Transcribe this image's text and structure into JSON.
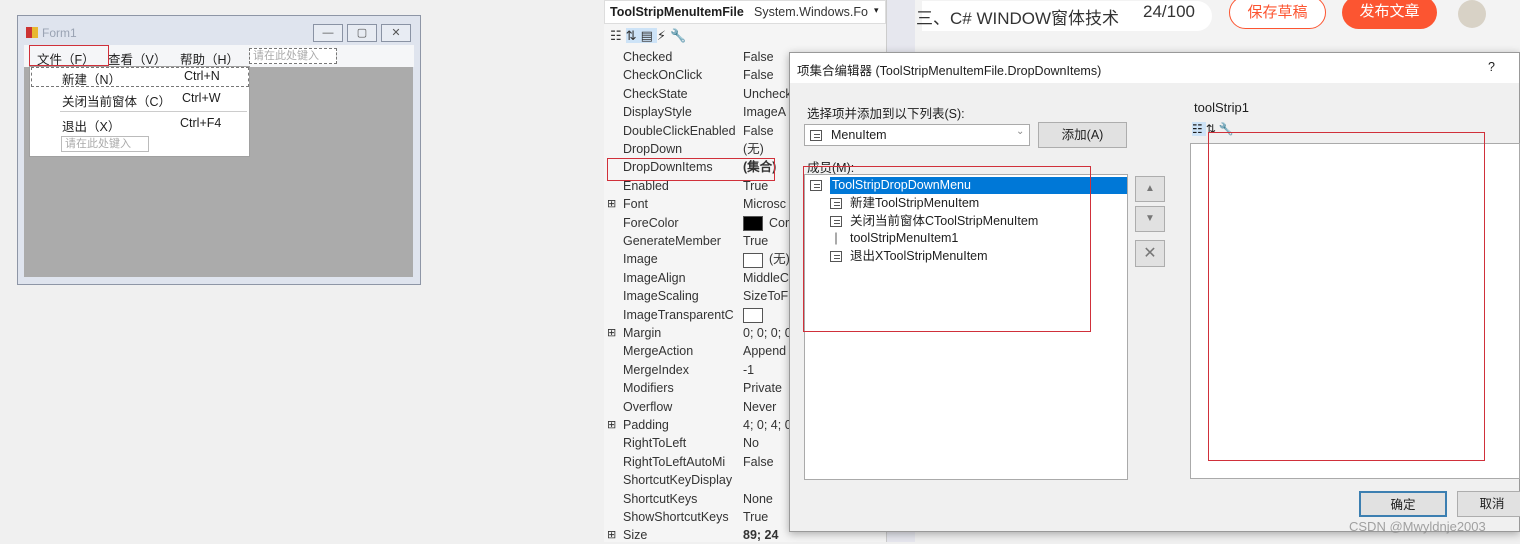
{
  "form": {
    "title": "Form1",
    "menu": [
      "文件（F）",
      "查看（V）",
      "帮助（H）"
    ],
    "type_here": "请在此处键入",
    "dropdown": [
      {
        "label": "新建（N）",
        "shortcut": "Ctrl+N"
      },
      {
        "label": "关闭当前窗体（C）",
        "shortcut": "Ctrl+W"
      },
      {
        "label": "退出（X）",
        "shortcut": "Ctrl+F4"
      }
    ]
  },
  "properties": {
    "object_name": "ToolStripMenuItemFile",
    "object_type": "System.Windows.Fo",
    "rows": [
      {
        "name": "Checked",
        "value": "False"
      },
      {
        "name": "CheckOnClick",
        "value": "False"
      },
      {
        "name": "CheckState",
        "value": "Uncheck"
      },
      {
        "name": "DisplayStyle",
        "value": "ImageA"
      },
      {
        "name": "DoubleClickEnabled",
        "value": "False"
      },
      {
        "name": "DropDown",
        "value": "(无)"
      },
      {
        "name": "DropDownItems",
        "value": "(集合)",
        "bold": true
      },
      {
        "name": "Enabled",
        "value": "True"
      },
      {
        "name": "Font",
        "value": "Microsc",
        "expand": true
      },
      {
        "name": "ForeColor",
        "value": "Cor",
        "swatch": "#000000"
      },
      {
        "name": "GenerateMember",
        "value": "True"
      },
      {
        "name": "Image",
        "value": "(无)",
        "swatch": "#ffffff"
      },
      {
        "name": "ImageAlign",
        "value": "MiddleC"
      },
      {
        "name": "ImageScaling",
        "value": "SizeToF"
      },
      {
        "name": "ImageTransparentC",
        "value": "",
        "swatch": "#ffffff"
      },
      {
        "name": "Margin",
        "value": "0; 0; 0; 0",
        "expand": true
      },
      {
        "name": "MergeAction",
        "value": "Append"
      },
      {
        "name": "MergeIndex",
        "value": "-1"
      },
      {
        "name": "Modifiers",
        "value": "Private"
      },
      {
        "name": "Overflow",
        "value": "Never"
      },
      {
        "name": "Padding",
        "value": "4; 0; 4; 0",
        "expand": true
      },
      {
        "name": "RightToLeft",
        "value": "No"
      },
      {
        "name": "RightToLeftAutoMi",
        "value": "False"
      },
      {
        "name": "ShortcutKeyDisplay",
        "value": ""
      },
      {
        "name": "ShortcutKeys",
        "value": "None"
      },
      {
        "name": "ShowShortcutKeys",
        "value": "True"
      },
      {
        "name": "Size",
        "value": "89; 24",
        "bold": true,
        "expand": true
      }
    ]
  },
  "csdn": {
    "article_title": "三、C# WINDOW窗体技术",
    "count": "24/100",
    "save_draft": "保存草稿",
    "publish": "发布文章",
    "accent": "#fc5531"
  },
  "dialog": {
    "title": "项集合编辑器 (ToolStripMenuItemFile.DropDownItems)",
    "help": "?",
    "select_label": "选择项并添加到以下列表(S):",
    "select_value": "MenuItem",
    "add_button": "添加(A)",
    "members_label": "成员(M):",
    "members": [
      {
        "label": "ToolStripDropDownMenu",
        "selected": true
      },
      {
        "label": "新建ToolStripMenuItem"
      },
      {
        "label": "关闭当前窗体CToolStripMenuItem"
      },
      {
        "label": "toolStripMenuItem1",
        "separator": true
      },
      {
        "label": "退出XToolStripMenuItem"
      }
    ],
    "right_title": "toolStrip1",
    "ok": "确定",
    "cancel": "取消"
  },
  "watermark": "CSDN @Mwyldnje2003"
}
